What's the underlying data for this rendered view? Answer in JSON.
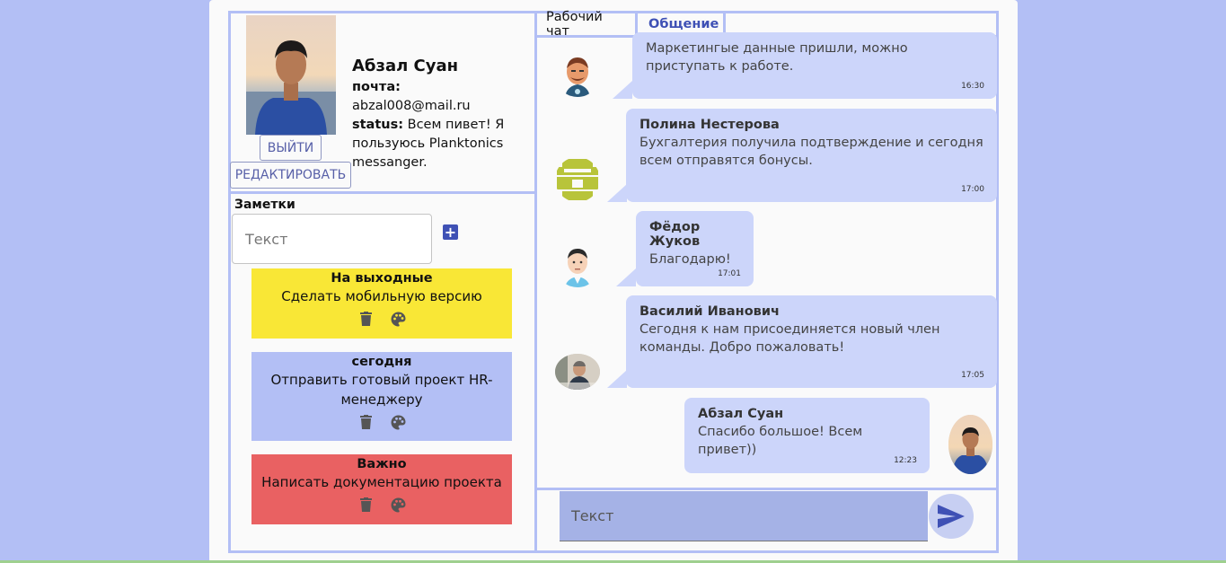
{
  "profile": {
    "name": "Абзал Суан",
    "email_label": "почта:",
    "email": "abzal008@mail.ru",
    "status_label": "status:",
    "status": "Всем пивет! Я пользуюсь Planktonics messanger.",
    "logout_label": "ВЫЙТИ",
    "edit_label": "РЕДАКТИРОВАТЬ"
  },
  "notes": {
    "title": "Заметки",
    "input_placeholder": "Текст",
    "add_icon": "plus-icon",
    "items": [
      {
        "title": "На выходные",
        "body": "Сделать мобильную версию",
        "color": "#f9e736"
      },
      {
        "title": "сегодня",
        "body": "Отправить готовый проект HR-менеджеру",
        "color": "#b3bff5"
      },
      {
        "title": "Важно",
        "body": "Написать документацию проекта",
        "color": "#e96162"
      }
    ]
  },
  "chat": {
    "tabs": [
      {
        "label": "Рабочий чат",
        "active": false
      },
      {
        "label": "Общение",
        "active": true
      }
    ],
    "messages": [
      {
        "author": "",
        "text": "Маркетингые данные пришли, можно приступать к работе.",
        "time": "16:30"
      },
      {
        "author": "Полина Нестерова",
        "text": "Бухгалтерия получила подтверждение и сегодня всем отправятся бонусы.",
        "time": "17:00"
      },
      {
        "author": "Фёдор Жуков",
        "text": "Благодарю!",
        "time": "17:01"
      },
      {
        "author": "Василий Иванович",
        "text": "Сегодня к нам присоединяется новый член команды. Добро пожаловать!",
        "time": "17:05"
      },
      {
        "author": "Абзал Суан",
        "text": "Спасибо большое! Всем привет))",
        "time": "12:23"
      }
    ],
    "input_placeholder": "Текст",
    "send_icon": "send-icon"
  },
  "colors": {
    "background": "#b3bff5",
    "accent": "#3f51b5",
    "bubble": "#ccd5fa"
  }
}
